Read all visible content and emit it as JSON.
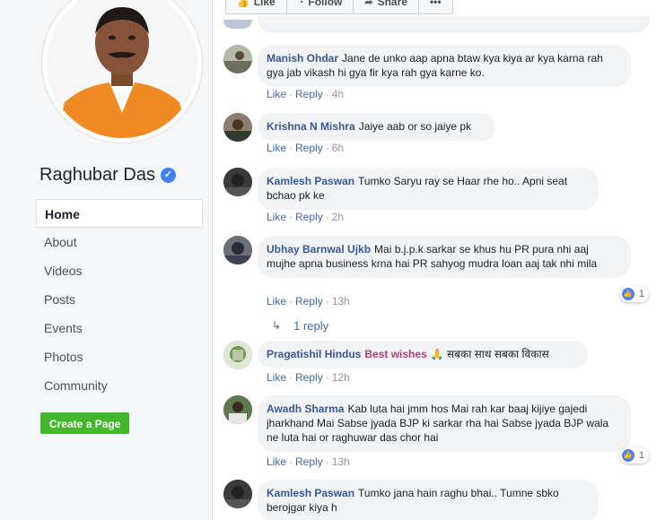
{
  "sidebar": {
    "page_name": "Raghubar Das",
    "verified_icon": "verified-badge-icon",
    "nav": [
      {
        "label": "Home",
        "active": true
      },
      {
        "label": "About",
        "active": false
      },
      {
        "label": "Videos",
        "active": false
      },
      {
        "label": "Posts",
        "active": false
      },
      {
        "label": "Events",
        "active": false
      },
      {
        "label": "Photos",
        "active": false
      },
      {
        "label": "Community",
        "active": false
      }
    ],
    "create_page_label": "Create a Page",
    "create_page_color": "#42b72a"
  },
  "action_bar": {
    "like_label": "Like",
    "follow_label": "Follow",
    "share_label": "Share",
    "more_icon": "more-dots-icon"
  },
  "comment_actions": {
    "like": "Like",
    "reply": "Reply"
  },
  "comments": [
    {
      "author": "Manish Ohdar",
      "text": "Jane de unko aap apna btaw kya kiya ar kya karna rah gya  jab vikash hi gya fir kya rah gya karne ko.",
      "time": "4h"
    },
    {
      "author": "Krishna N Mishra",
      "text": "Jaiye aab or so jaiye pk",
      "time": "6h"
    },
    {
      "author": "Kamlesh Paswan",
      "text": "Tumko Saryu ray se Haar rhe ho.. Apni seat bchao pk ke",
      "time": "2h"
    },
    {
      "author": "Ubhay Barnwal Ujkb",
      "text": "Mai b.j.p.k sarkar se khus hu PR pura nhi aaj mujhe apna business krna hai PR sahyog mudra loan aaj tak nhi mila",
      "time": "13h",
      "reactions": "1"
    },
    {
      "author": "Pragatishil Hindus",
      "author2": "Best wishes",
      "text": "🙏 सबका साथ सबका विकास",
      "time": "12h"
    },
    {
      "author": "Awadh Sharma",
      "text": "Kab luta hai jmm hos Mai rah kar baaj kijiye gajedi jharkhand Mai Sabse jyada BJP ki sarkar rha hai Sabse jyada BJP wala ne luta hai or raghuwar das chor hai",
      "time": "13h",
      "reactions": "1"
    },
    {
      "author": "Kamlesh Paswan",
      "text": "Tumko jana hain raghu bhai.. Tumne sbko berojgar kiya h"
    }
  ],
  "reply_link": "1 reply",
  "colors": {
    "link": "#385898",
    "like_blue": "#4e82f3",
    "bubble": "#f2f3f5"
  }
}
